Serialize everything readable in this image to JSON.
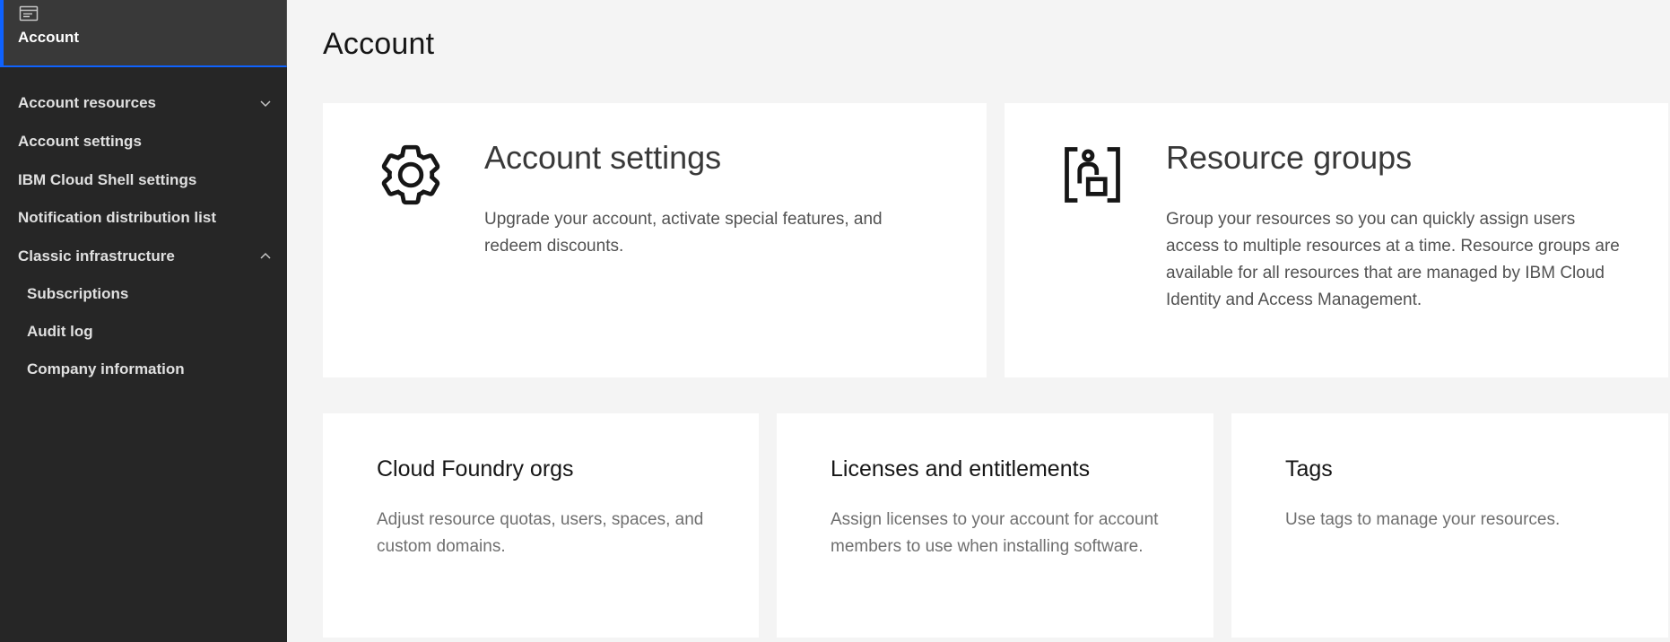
{
  "sidebar": {
    "header": {
      "label": "Account",
      "icon": "account-card-icon"
    },
    "items": [
      {
        "label": "Account resources",
        "expandable": true,
        "expanded": false
      },
      {
        "label": "Account settings"
      },
      {
        "label": "IBM Cloud Shell settings"
      },
      {
        "label": "Notification distribution list"
      },
      {
        "label": "Classic infrastructure",
        "expandable": true,
        "expanded": true
      },
      {
        "label": "Subscriptions",
        "sub": true
      },
      {
        "label": "Audit log",
        "sub": true
      },
      {
        "label": "Company information",
        "sub": true
      }
    ]
  },
  "main": {
    "title": "Account",
    "cards_large": [
      {
        "title": "Account settings",
        "description": "Upgrade your account, activate special features, and redeem discounts.",
        "icon": "gear-icon"
      },
      {
        "title": "Resource groups",
        "description": "Group your resources so you can quickly assign users access to multiple resources at a time. Resource groups are available for all resources that are managed by IBM Cloud Identity and Access Management.",
        "icon": "resource-group-icon"
      }
    ],
    "cards_small": [
      {
        "title": "Cloud Foundry orgs",
        "description": "Adjust resource quotas, users, spaces, and custom domains."
      },
      {
        "title": "Licenses and entitlements",
        "description": "Assign licenses to your account for account members to use when installing software."
      },
      {
        "title": "Tags",
        "description": "Use tags to manage your resources."
      }
    ]
  },
  "colors": {
    "sidebar_bg": "#262626",
    "sidebar_header_bg": "#393939",
    "accent": "#0f62fe",
    "page_bg": "#f4f4f4",
    "card_bg": "#ffffff"
  }
}
